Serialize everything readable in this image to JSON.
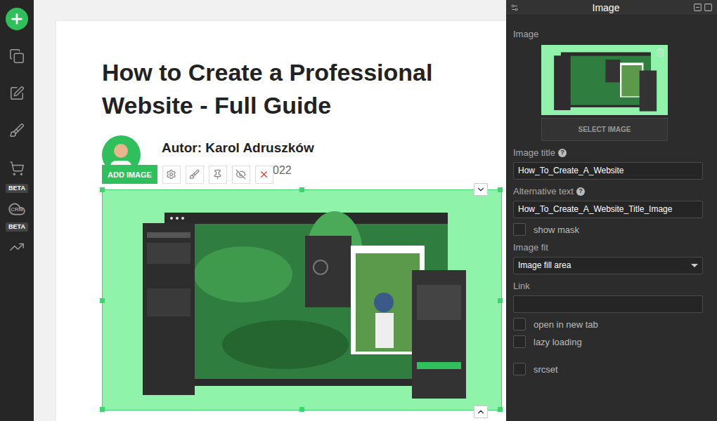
{
  "sidebar": {
    "items": [
      {
        "kind": "add"
      },
      {
        "kind": "pages"
      },
      {
        "kind": "edit"
      },
      {
        "kind": "design"
      },
      {
        "kind": "shop",
        "badge": "BETA"
      },
      {
        "kind": "crm",
        "label": "CRM",
        "badge": "BETA"
      },
      {
        "kind": "stats"
      }
    ]
  },
  "article": {
    "title": "How to Create a Professional Website - Full Guide",
    "author": "Autor: Karol Adruszków",
    "date_fragment": "022"
  },
  "toolbar": {
    "add_button": "ADD IMAGE",
    "tools": [
      {
        "kind": "settings"
      },
      {
        "kind": "style"
      },
      {
        "kind": "pin"
      },
      {
        "kind": "hide"
      },
      {
        "kind": "delete"
      }
    ]
  },
  "panel": {
    "title": "Image",
    "image_label": "Image",
    "select_button": "SELECT IMAGE",
    "fields": [
      {
        "kind": "text",
        "label": "Image title",
        "help": "?",
        "value": "How_To_Create_A_Website"
      },
      {
        "kind": "text",
        "label": "Alternative text",
        "help": "?",
        "value": "How_To_Create_A_Website_Title_Image"
      },
      {
        "kind": "checkbox",
        "label": "show mask",
        "checked": false
      },
      {
        "kind": "select",
        "label": "Image fit",
        "value": "Image fill area"
      },
      {
        "kind": "text",
        "label": "Link",
        "value": ""
      },
      {
        "kind": "checkbox",
        "label": "open in new tab",
        "checked": false
      },
      {
        "kind": "checkbox",
        "label": "lazy loading",
        "checked": false
      },
      {
        "kind": "checkbox",
        "label": "srcset",
        "checked": false
      }
    ]
  }
}
